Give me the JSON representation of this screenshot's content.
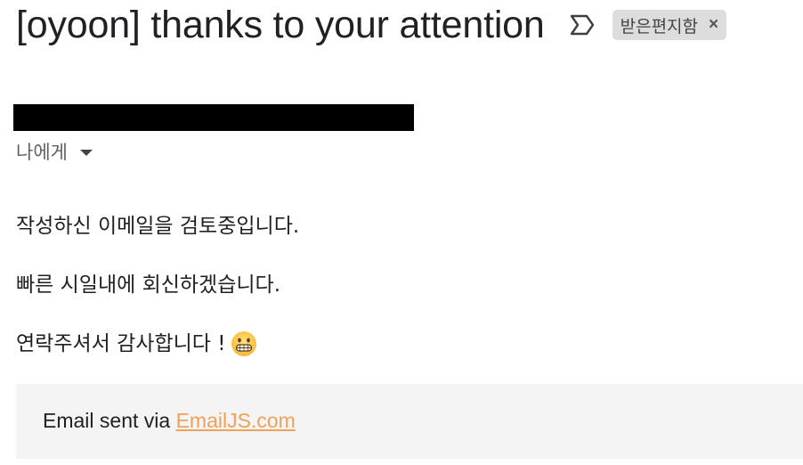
{
  "email": {
    "subject": "[oyoon] thanks to your attention",
    "label_chip": "받은편지함",
    "label_close": "×",
    "recipient": "나에게",
    "body_lines": [
      "작성하신 이메일을 검토중입니다.",
      "빠른 시일내에 회신하겠습니다.",
      "연락주셔서 감사합니다 !"
    ],
    "footer": {
      "prefix": "Email sent via ",
      "link_text": "EmailJS.com"
    }
  },
  "icons": {
    "importance": "importance-marker-icon",
    "emoji": "grinning-face-icon",
    "caret": "caret-down-icon"
  },
  "colors": {
    "chip_background": "#dddddd",
    "footer_background": "#f4f4f4",
    "link": "#f0a05a",
    "redaction": "#000000"
  }
}
